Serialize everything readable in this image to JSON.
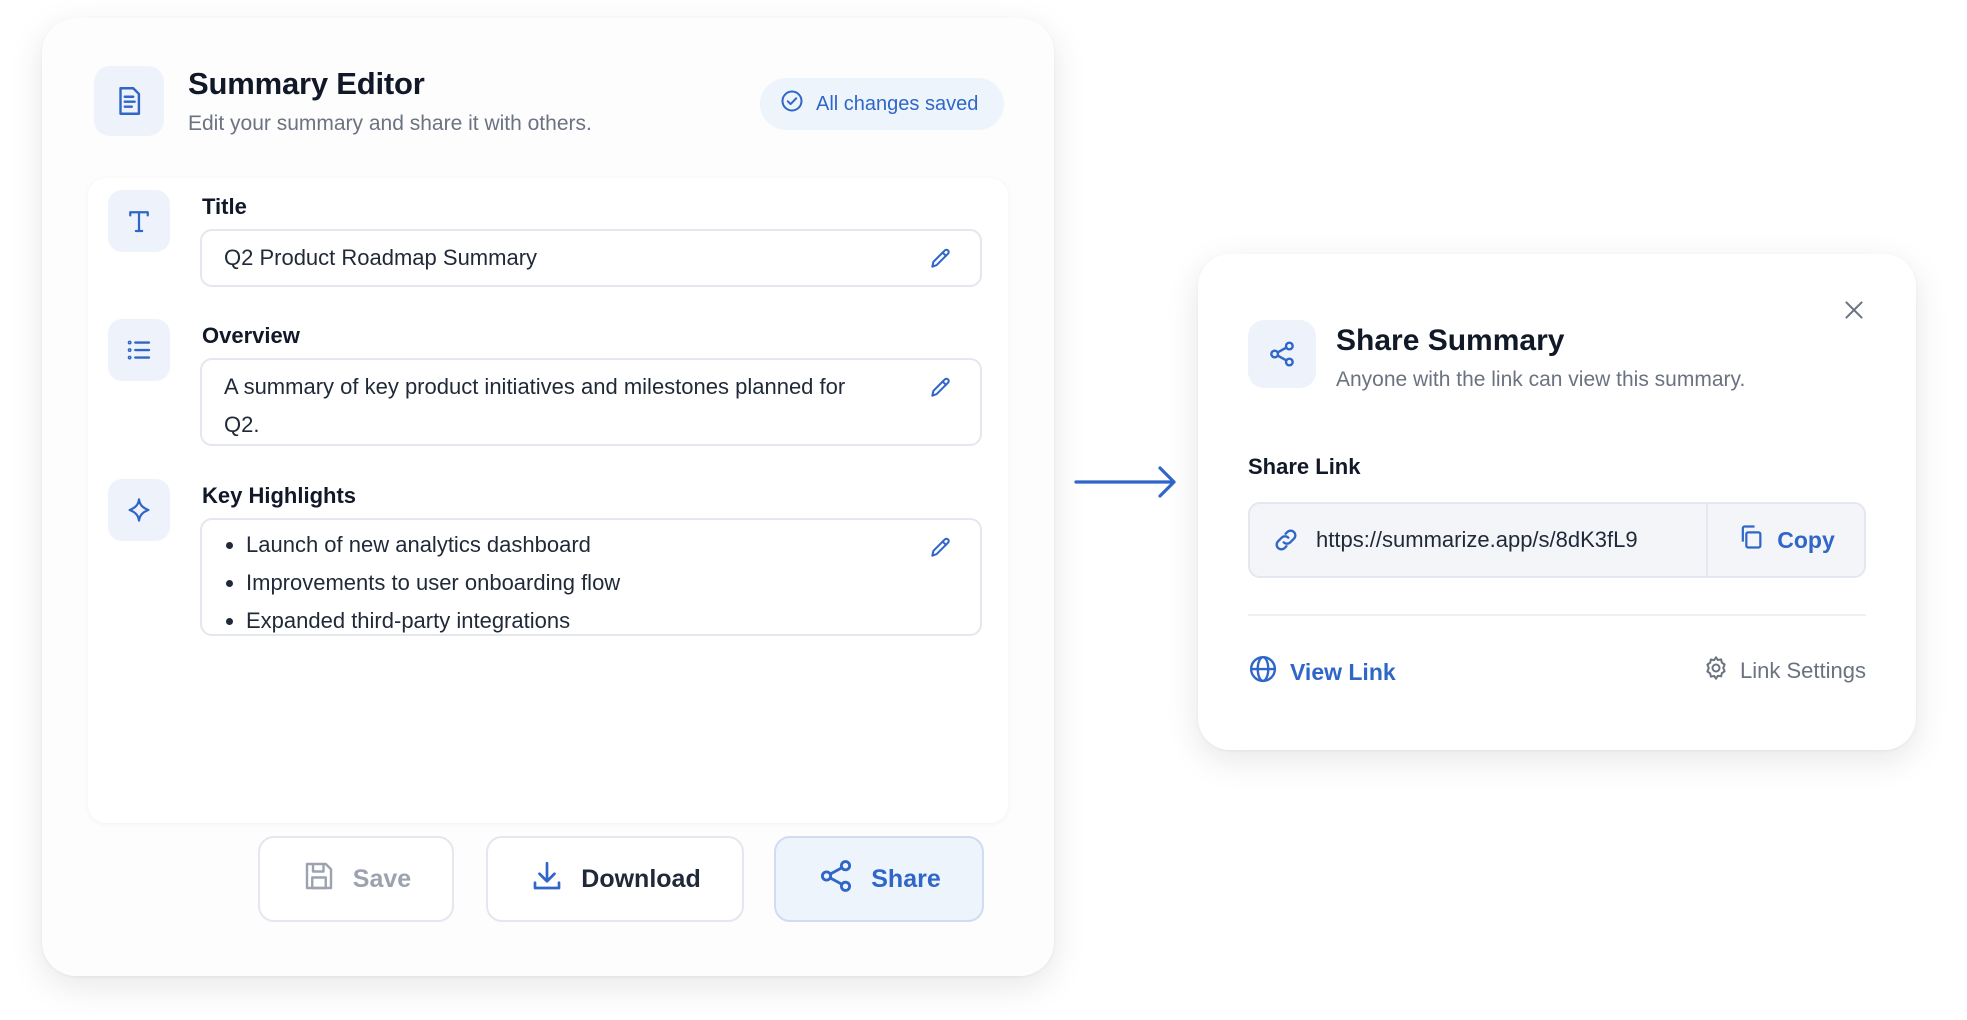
{
  "editor": {
    "title": "Summary Editor",
    "subtitle": "Edit your summary and share it with others.",
    "status_badge": "All changes saved",
    "fields": {
      "title": {
        "label": "Title",
        "value": "Q2 Product Roadmap Summary"
      },
      "overview": {
        "label": "Overview",
        "value": "A summary of key product initiatives and milestones planned for Q2."
      },
      "highlights": {
        "label": "Key Highlights",
        "items": [
          "Launch of new analytics dashboard",
          "Improvements to user onboarding flow",
          "Expanded third-party integrations"
        ]
      }
    },
    "actions": {
      "save": "Save",
      "download": "Download",
      "share": "Share"
    }
  },
  "share_dialog": {
    "title": "Share Summary",
    "subtitle": "Anyone with the link can view this summary.",
    "link_label": "Share Link",
    "link_url": "https://summarize.app/s/8dK3fL9",
    "copy": "Copy",
    "view_link": "View Link",
    "link_settings": "Link Settings"
  },
  "icons": {
    "editor_header": "document-icon",
    "status": "check-circle-icon",
    "title_field": "text-type-icon",
    "overview_field": "list-icon",
    "highlights_field": "sparkle-icon",
    "edit": "pencil-icon",
    "save": "floppy-disk-icon",
    "download": "download-icon",
    "share": "share-icon",
    "close": "close-icon",
    "link": "link-icon",
    "copy": "copy-icon",
    "view": "globe-icon",
    "settings": "gear-icon",
    "flow": "arrow-right-icon"
  },
  "colors": {
    "accent": "#2f66c8",
    "accent_soft": "#eef4fc",
    "text_primary": "#111827",
    "text_secondary": "#6b7280",
    "border": "#e3e7ee"
  }
}
